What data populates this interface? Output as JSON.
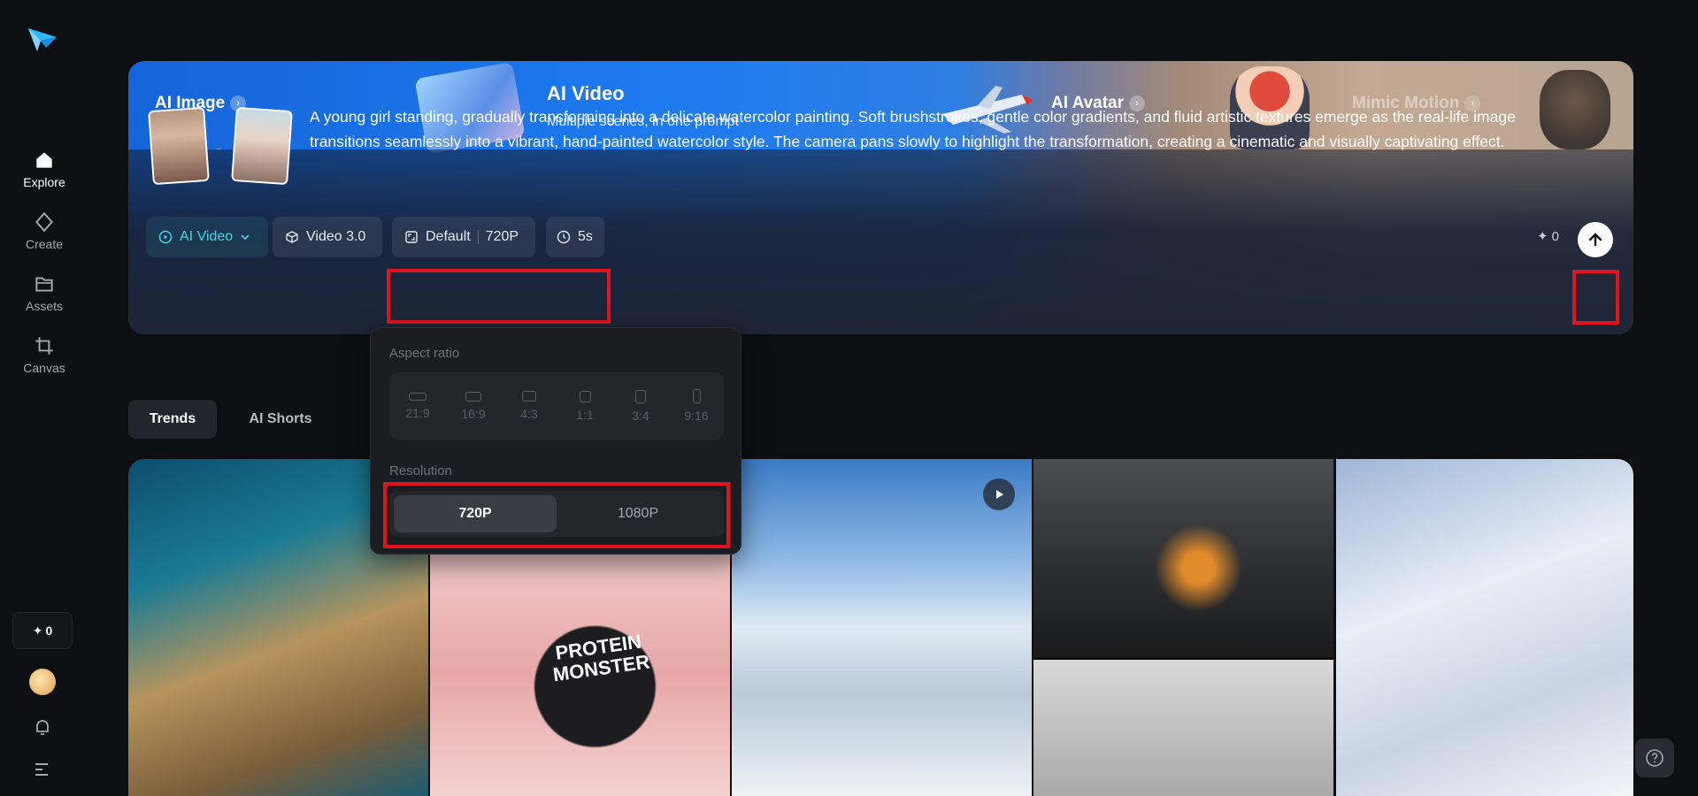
{
  "sidebar": {
    "items": [
      {
        "label": "Explore",
        "icon": "home-icon",
        "active": true
      },
      {
        "label": "Create",
        "icon": "diamond-icon"
      },
      {
        "label": "Assets",
        "icon": "folder-icon"
      },
      {
        "label": "Canvas",
        "icon": "crop-icon"
      }
    ],
    "credits": "0"
  },
  "hero": {
    "tabs": {
      "ai_image": "AI Image",
      "ai_video_title": "AI Video",
      "ai_video_subtitle": "Multiple scenes, in one prompt",
      "ai_avatar": "AI Avatar",
      "mimic_motion": "Mimic Motion"
    },
    "prompt": "A young girl standing, gradually transforming into a delicate watercolor painting. Soft brushstrokes, gentle color gradients, and fluid artistic textures emerge as the real-life image transitions seamlessly into a vibrant, hand-painted watercolor style. The camera pans slowly to highlight the transformation, creating a cinematic and visually captivating effect.",
    "controls": {
      "mode": "AI Video",
      "model": "Video 3.0",
      "aspect": "Default",
      "resolution": "720P",
      "duration": "5s"
    },
    "credits": "0"
  },
  "tabs": {
    "trends": "Trends",
    "ai_shorts": "AI Shorts"
  },
  "popover": {
    "aspect_label": "Aspect ratio",
    "ratios": [
      "21:9",
      "16:9",
      "4:3",
      "1:1",
      "3:4",
      "9:16"
    ],
    "resolution_label": "Resolution",
    "resolutions": [
      "720P",
      "1080P"
    ],
    "selected_resolution": "720P"
  },
  "gallery": {
    "product_text": "PROTEIN MONSTER"
  },
  "colors": {
    "accent": "#45d4e8",
    "highlight": "#e0141e",
    "hero_blue": "#1e7af0"
  }
}
